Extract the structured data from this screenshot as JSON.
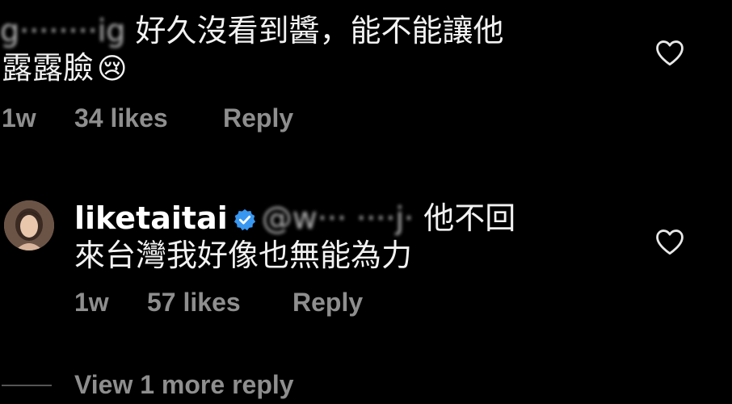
{
  "comment1": {
    "username_obscured": "g········ig",
    "text_line1": "好久沒看到醬，能不能讓他",
    "text_line2": "露露臉",
    "emoji": "😢",
    "time": "1w",
    "likes": "34 likes",
    "reply": "Reply"
  },
  "comment2": {
    "username": "liketaitai",
    "mention_obscured": "@w··· ····j·",
    "text_line1_end": "他不回",
    "text_line2": "來台灣我好像也無能為力",
    "time": "1w",
    "likes": "57 likes",
    "reply": "Reply"
  },
  "view_more": "View 1 more reply",
  "icons": {
    "like": "heart-outline-icon",
    "verified": "verified-badge-icon"
  },
  "colors": {
    "background": "#000000",
    "meta_text": "#8e8e8e",
    "verified_blue": "#3897f0"
  }
}
